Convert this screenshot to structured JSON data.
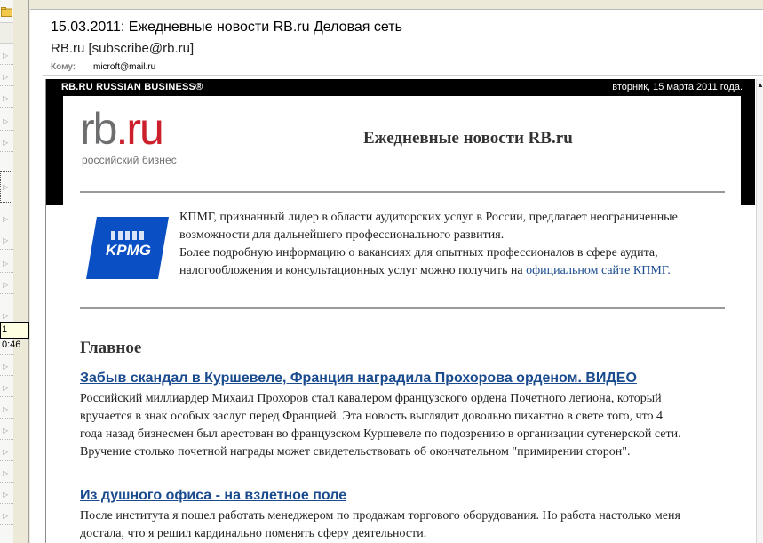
{
  "tooltip": {
    "text": "1 0:46"
  },
  "email": {
    "subject": "15.03.2011: Ежедневные новости RB.ru Деловая сеть",
    "sender": "RB.ru [subscribe@rb.ru]",
    "to_label": "Кому:",
    "to_value": "microft@mail.ru"
  },
  "newsletter": {
    "brand": "RB.RU RUSSIAN BUSINESS®",
    "date": "вторник, 15 марта 2011 года.",
    "logo_main": "rb",
    "logo_suffix": ".ru",
    "logo_tagline": "российский бизнес",
    "title": "Ежедневные новости RB.ru",
    "kpmg": {
      "logo_text": "KPMG",
      "paragraph_1": "КПМГ, признанный лидер в области аудиторских услуг в России, предлагает неограниченные возможности для дальнейшего профессионального развития.",
      "paragraph_2": "Более подробную информацию о вакансиях для опытных профессионалов в сфере аудита, налогообложения и консультационных услуг можно получить на",
      "link": "официальном сайте КПМГ."
    },
    "section_heading": "Главное",
    "articles": [
      {
        "title": "Забыв скандал в Куршевеле, Франция наградила Прохорова орденом. ВИДЕО",
        "body": "Российский миллиардер Михаил Прохоров стал кавалером французского ордена Почетного легиона, который вручается в знак особых заслуг перед Францией. Эта новость выглядит довольно пикантно в свете того, что 4 года назад бизнесмен был арестован во французском Куршевеле по подозрению в организации сутенерской сети. Вручение столько почетной награды может свидетельствовать об окончательном \"примирении сторон\"."
      },
      {
        "title": "Из душного офиса - на взлетное поле",
        "body": "После института я пошел работать менеджером по продажам торгового оборудования. Но работа настолько меня достала, что я решил кардинально поменять сферу деятельности."
      }
    ]
  },
  "colors": {
    "link": "#1a4b8f",
    "rb_red": "#cc1f2c",
    "rb_gray": "#6d6e70",
    "kpmg_blue": "#0a4fc4"
  }
}
